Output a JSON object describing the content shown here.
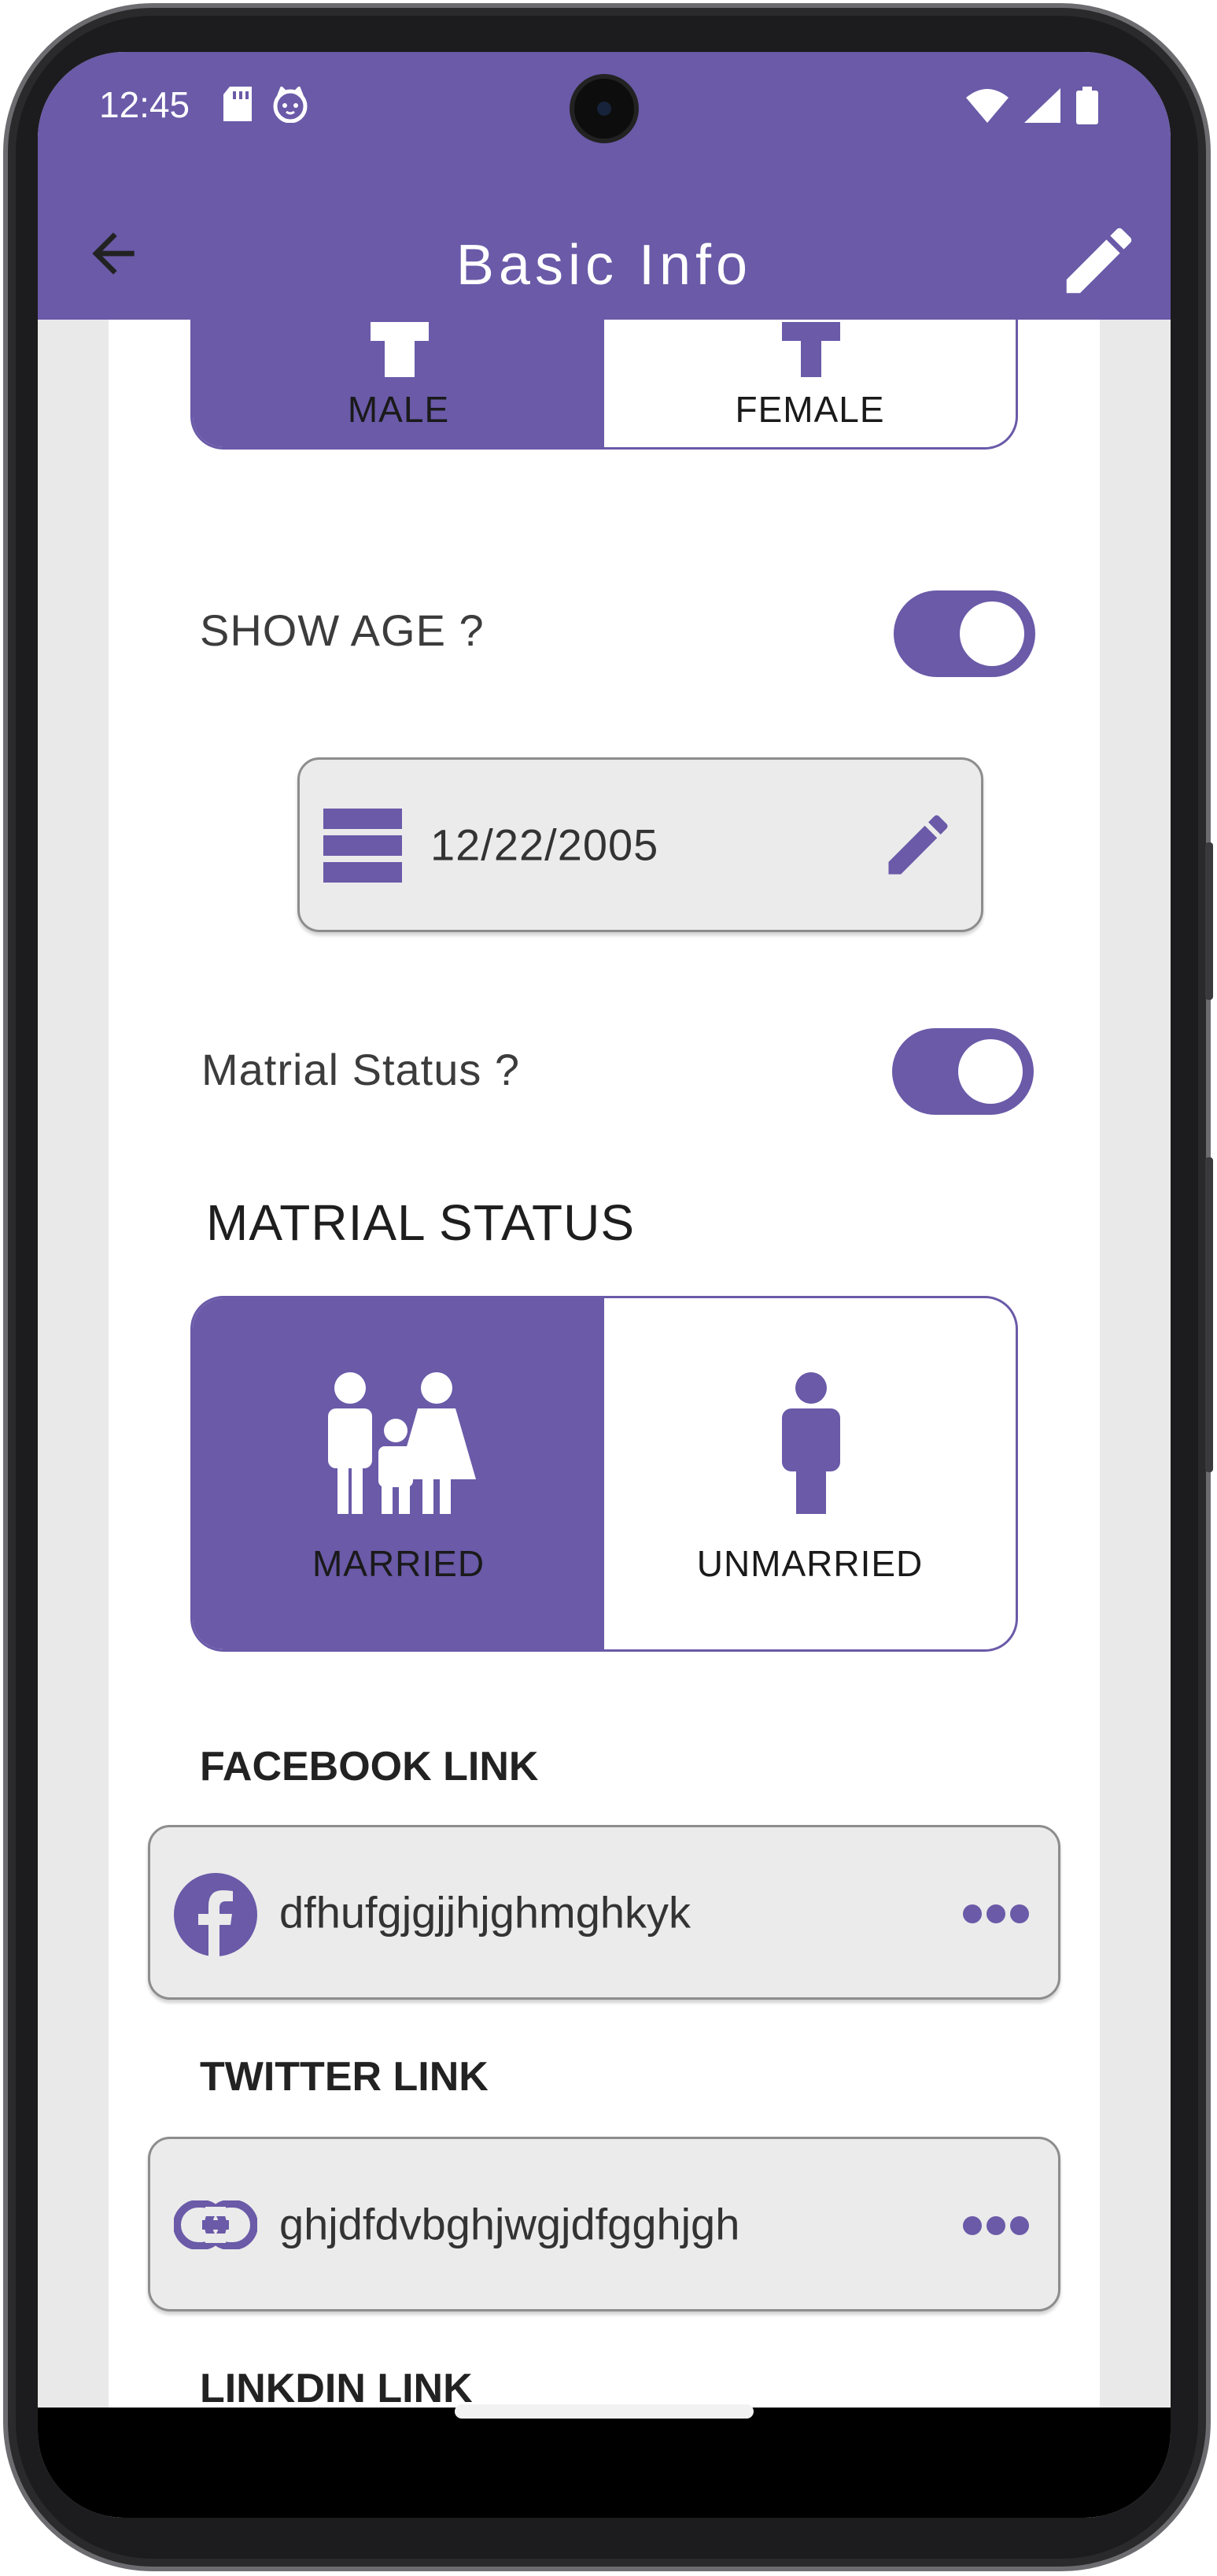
{
  "status_bar": {
    "time": "12:45"
  },
  "app_bar": {
    "title": "Basic Info"
  },
  "gender": {
    "options": [
      {
        "label": "MALE",
        "selected": true
      },
      {
        "label": "FEMALE",
        "selected": false
      }
    ]
  },
  "show_age": {
    "label": "SHOW AGE ?",
    "enabled": true
  },
  "birthdate": {
    "value": "12/22/2005"
  },
  "marital_toggle": {
    "label": "Matrial Status ?",
    "enabled": true
  },
  "marital": {
    "heading": "MATRIAL STATUS",
    "options": [
      {
        "label": "MARRIED",
        "selected": true
      },
      {
        "label": "UNMARRIED",
        "selected": false
      }
    ]
  },
  "facebook": {
    "heading": "FACEBOOK LINK",
    "value": "dfhufgjgjjhjghmghkyk"
  },
  "twitter": {
    "heading": "TWITTER LINK",
    "value": "ghjdfdvbghjwgjdfgghjgh"
  },
  "linkedin": {
    "heading": "LINKDIN LINK",
    "value": ""
  },
  "colors": {
    "primary": "#6a5aa8",
    "field_bg": "#ebebeb",
    "page_bg": "#e9e9e9"
  },
  "icons": [
    "arrow-back-icon",
    "edit-pencil-icon",
    "calendar-icon",
    "facebook-icon",
    "link-icon",
    "more-horiz-icon",
    "family-icon",
    "person-icon"
  ]
}
